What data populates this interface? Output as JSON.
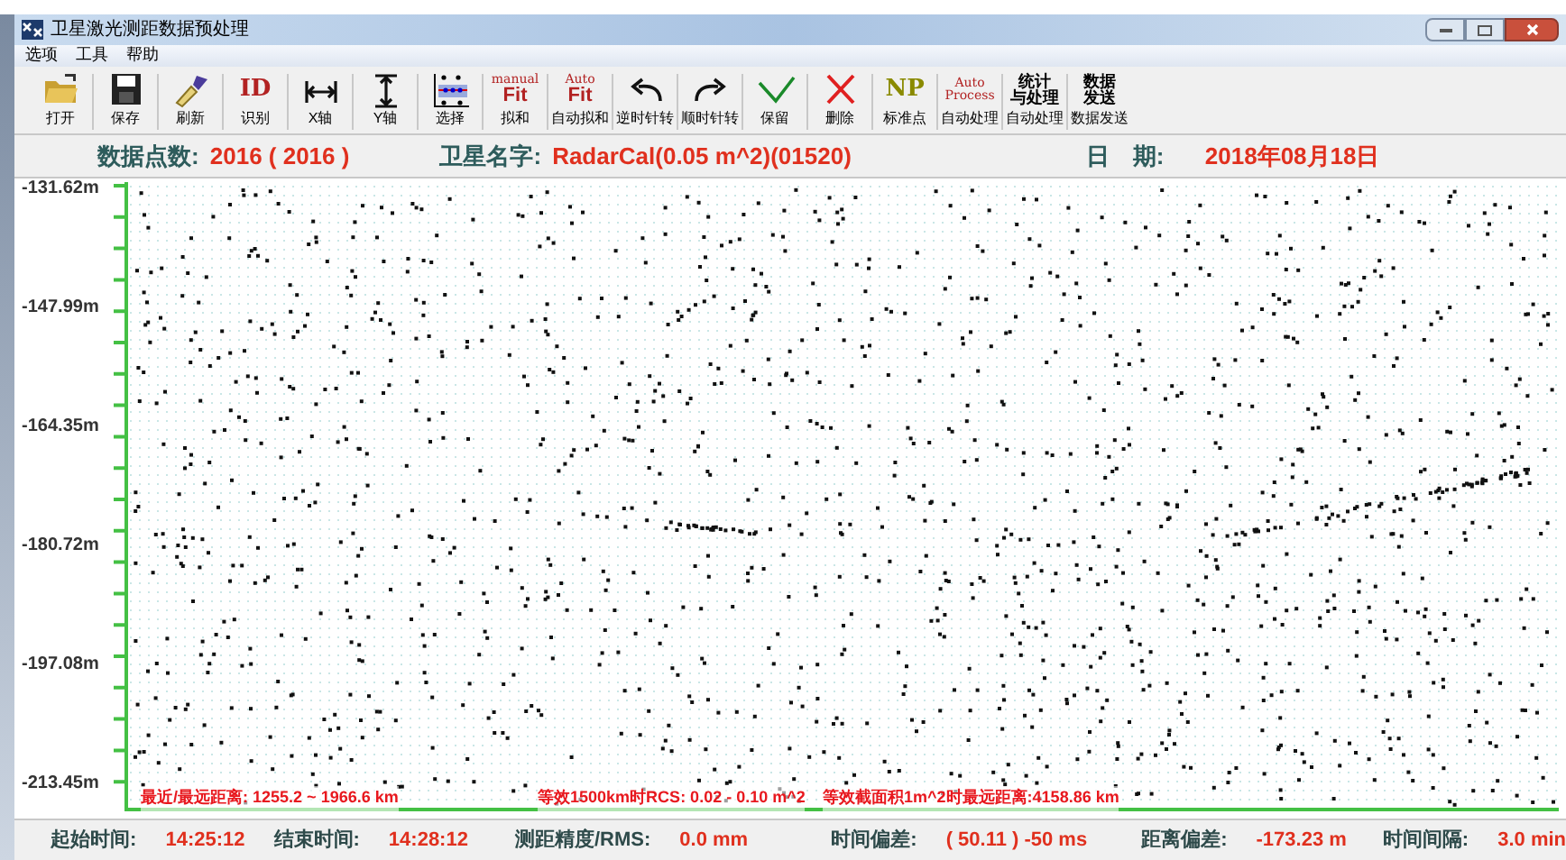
{
  "window": {
    "title": "卫星激光测距数据预处理"
  },
  "menu": [
    "选项",
    "工具",
    "帮助"
  ],
  "toolbar": [
    {
      "kind": "open",
      "label": "打开"
    },
    {
      "kind": "save",
      "label": "保存"
    },
    {
      "kind": "brush",
      "label": "刷新"
    },
    {
      "kind": "text",
      "icon_text": "ID",
      "color": "#b22222",
      "label": "识别"
    },
    {
      "kind": "xaxis",
      "label": "X轴"
    },
    {
      "kind": "yaxis",
      "label": "Y轴"
    },
    {
      "kind": "select",
      "label": "选择"
    },
    {
      "kind": "fit",
      "small_text": "manual",
      "icon_text": "Fit",
      "color": "#b22222",
      "label": "拟和"
    },
    {
      "kind": "fit",
      "small_text": "Auto",
      "icon_text": "Fit",
      "color": "#b22222",
      "label": "自动拟和"
    },
    {
      "kind": "ccw",
      "label": "逆时针转"
    },
    {
      "kind": "cw",
      "label": "顺时针转"
    },
    {
      "kind": "check",
      "label": "保留"
    },
    {
      "kind": "cross",
      "label": "删除"
    },
    {
      "kind": "text",
      "icon_text": "NP",
      "color": "#8a8a00",
      "label": "标准点"
    },
    {
      "kind": "fit",
      "small_text": "Auto",
      "icon_text": "Process",
      "color": "#b22222",
      "label": "自动处理"
    },
    {
      "kind": "stack",
      "lines": [
        "统计",
        "与处理"
      ],
      "label": "自动处理"
    },
    {
      "kind": "stack",
      "lines": [
        "数据",
        "发送"
      ],
      "label": "数据发送"
    }
  ],
  "info": [
    {
      "label": "数据点数:",
      "value": "2016 ( 2016 )"
    },
    {
      "label": "卫星名字:",
      "value": "RadarCal(0.05 m^2)(01520)"
    },
    {
      "label": "日　期:",
      "value": "2018年08月18日"
    }
  ],
  "plot": {
    "y_labels": [
      "-131.62m",
      "-147.99m",
      "-164.35m",
      "-180.72m",
      "-197.08m",
      "-213.45m"
    ],
    "notes": [
      "最近/最远距离: 1255.2 ~ 1966.6 km",
      "等效1500km时RCS: 0.02 - 0.10 m^2",
      "等效截面积1m^2时最远距离:4158.86 km"
    ]
  },
  "status": [
    {
      "label": "起始时间:",
      "value": "14:25:12"
    },
    {
      "label": "结束时间:",
      "value": "14:28:12"
    },
    {
      "label": "测距精度/RMS:",
      "value": "0.0 mm"
    },
    {
      "label": "时间偏差:",
      "value": "( 50.11 ) -50 ms"
    },
    {
      "label": "距离偏差:",
      "value": "-173.23 m"
    },
    {
      "label": "时间间隔:",
      "value": "3.0 min"
    }
  ]
}
